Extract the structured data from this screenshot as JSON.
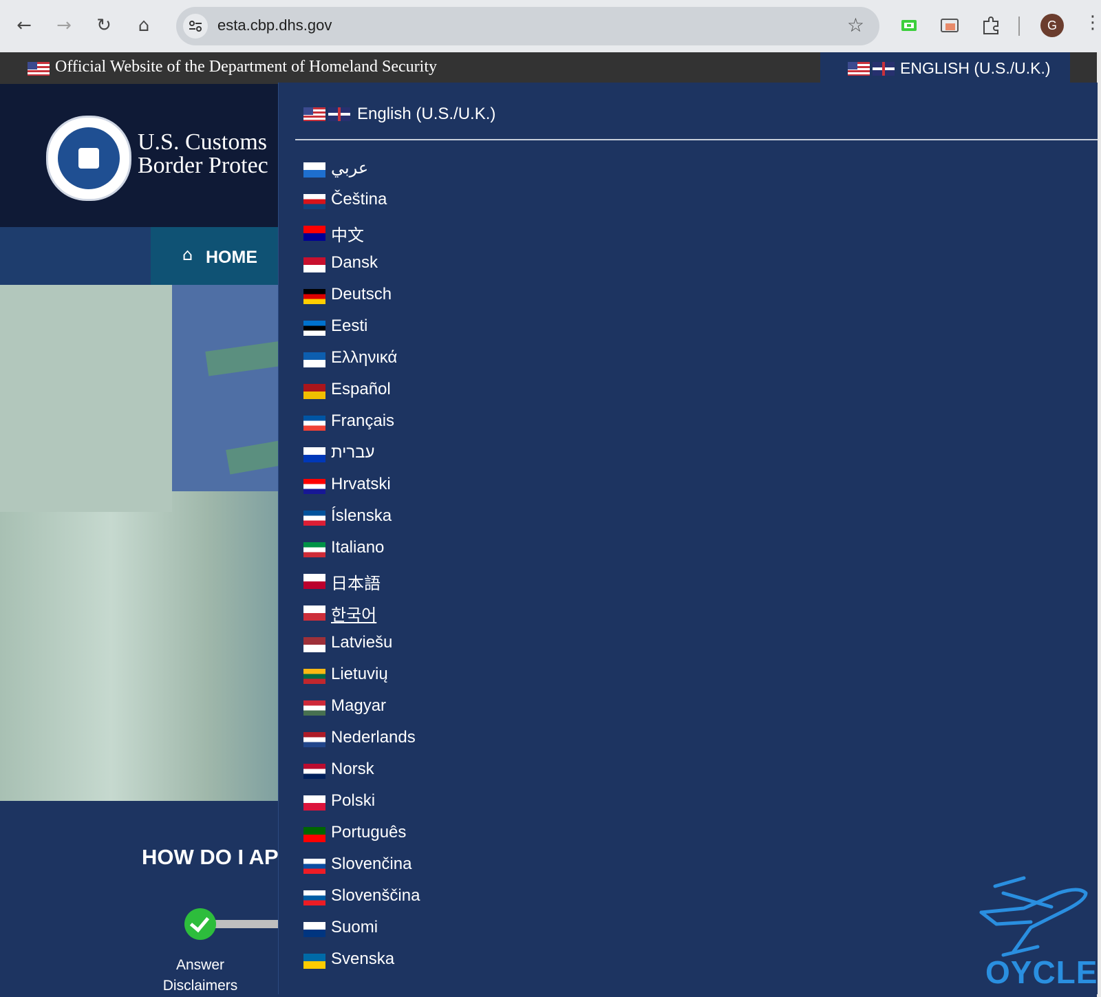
{
  "browser": {
    "url": "esta.cbp.dhs.gov",
    "avatar_letter": "G",
    "icons": [
      "back-icon",
      "forward-icon",
      "reload-icon",
      "home-icon",
      "tune-icon",
      "star-icon",
      "extension-icon",
      "cast-icon",
      "puzzle-icon",
      "kebab-icon"
    ]
  },
  "banner": {
    "official_text": "Official Website of the Department of Homeland Security",
    "language_toggle": "ENGLISH (U.S./U.K.)"
  },
  "header": {
    "agency_line1": "U.S. Customs",
    "agency_line2": "Border Protec"
  },
  "nav": {
    "home_label": "HOME"
  },
  "page": {
    "howto_heading": "HOW DO I AP",
    "step1_line1": "Answer",
    "step1_line2": "Disclaimers"
  },
  "dropdown": {
    "current_language": "English (U.S./U.K.)",
    "languages": [
      {
        "label": "عربي",
        "flag_colors": [
          "#ffffff",
          "#1e6fcf"
        ]
      },
      {
        "label": "Čeština",
        "flag_colors": [
          "#ffffff",
          "#d7141a",
          "#11457e"
        ]
      },
      {
        "label": "中文",
        "flag_colors": [
          "#fe0000",
          "#000095"
        ]
      },
      {
        "label": "Dansk",
        "flag_colors": [
          "#c8102e",
          "#ffffff"
        ]
      },
      {
        "label": "Deutsch",
        "flag_colors": [
          "#000000",
          "#dd0000",
          "#ffce00"
        ]
      },
      {
        "label": "Eesti",
        "flag_colors": [
          "#0072ce",
          "#000000",
          "#ffffff"
        ]
      },
      {
        "label": "Ελληνικά",
        "flag_colors": [
          "#0d5eaf",
          "#ffffff"
        ]
      },
      {
        "label": "Español",
        "flag_colors": [
          "#aa151b",
          "#f1bf00"
        ]
      },
      {
        "label": "Français",
        "flag_colors": [
          "#0055a4",
          "#ffffff",
          "#ef4135"
        ]
      },
      {
        "label": "עברית",
        "flag_colors": [
          "#ffffff",
          "#0038b8"
        ]
      },
      {
        "label": "Hrvatski",
        "flag_colors": [
          "#ff0000",
          "#ffffff",
          "#171796"
        ]
      },
      {
        "label": "Íslenska",
        "flag_colors": [
          "#02529c",
          "#ffffff",
          "#dc1e35"
        ]
      },
      {
        "label": "Italiano",
        "flag_colors": [
          "#009246",
          "#ffffff",
          "#ce2b37"
        ]
      },
      {
        "label": "日本語",
        "flag_colors": [
          "#ffffff",
          "#bc002d"
        ]
      },
      {
        "label": "한국어",
        "flag_colors": [
          "#ffffff",
          "#cd2e3a"
        ]
      },
      {
        "label": "Latviešu",
        "flag_colors": [
          "#9e3039",
          "#ffffff"
        ]
      },
      {
        "label": "Lietuvių",
        "flag_colors": [
          "#fdb913",
          "#006a44",
          "#c1272d"
        ]
      },
      {
        "label": "Magyar",
        "flag_colors": [
          "#ce2939",
          "#ffffff",
          "#477050"
        ]
      },
      {
        "label": "Nederlands",
        "flag_colors": [
          "#ae1c28",
          "#ffffff",
          "#21468b"
        ]
      },
      {
        "label": "Norsk",
        "flag_colors": [
          "#ba0c2f",
          "#ffffff",
          "#00205b"
        ]
      },
      {
        "label": "Polski",
        "flag_colors": [
          "#ffffff",
          "#dc143c"
        ]
      },
      {
        "label": "Português",
        "flag_colors": [
          "#006600",
          "#ff0000"
        ]
      },
      {
        "label": "Slovenčina",
        "flag_colors": [
          "#ffffff",
          "#0b4ea2",
          "#ee1c25"
        ]
      },
      {
        "label": "Slovenščina",
        "flag_colors": [
          "#ffffff",
          "#005da4",
          "#ed1c24"
        ]
      },
      {
        "label": "Suomi",
        "flag_colors": [
          "#ffffff",
          "#003580"
        ]
      },
      {
        "label": "Svenska",
        "flag_colors": [
          "#006aa7",
          "#fecc00"
        ]
      }
    ]
  },
  "watermark": {
    "text": "OYCLE",
    "color": "#2a8fe0"
  }
}
